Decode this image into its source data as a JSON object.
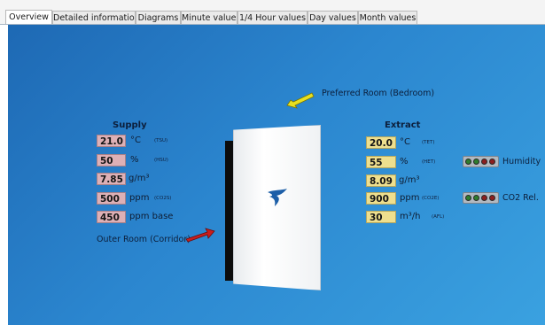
{
  "tabs": [
    "Overview",
    "Detailed information",
    "Diagrams",
    "Minute values",
    "1/4 Hour values",
    "Day values",
    "Month values"
  ],
  "supply": {
    "title": "Supply",
    "temperature": {
      "value": "21.0",
      "unit": "°C",
      "tag": "(TSU)"
    },
    "humidity": {
      "value": "50",
      "unit": "%",
      "tag": "(HSU)"
    },
    "absolute": {
      "value": "7.85",
      "unit": "g/m³"
    },
    "co2": {
      "value": "500",
      "unit": "ppm",
      "tag": "(CO2S)"
    },
    "base": {
      "value": "450",
      "unit": "ppm base"
    }
  },
  "extract": {
    "title": "Extract",
    "temperature": {
      "value": "20.0",
      "unit": "°C",
      "tag": "(TET)"
    },
    "humidity": {
      "value": "55",
      "unit": "%",
      "tag": "(HET)"
    },
    "absolute": {
      "value": "8.09",
      "unit": "g/m³"
    },
    "co2": {
      "value": "900",
      "unit": "ppm",
      "tag": "(CO2E)"
    },
    "flow": {
      "value": "30",
      "unit": "m³/h",
      "tag": "(AFL)"
    }
  },
  "captions": {
    "preferred_room": "Preferred Room (Bedroom)",
    "outer_room": "Outer Room (Corridor)"
  },
  "indicators": {
    "humidity_label": "Humidity",
    "co2_label": "CO2 Rel."
  },
  "colors": {
    "background_start": "#1e69b4",
    "background_end": "#3aa1e0",
    "supply_field": "#ddb0b6",
    "extract_field": "#eedf8e",
    "arrow_yellow": "#e8e020",
    "arrow_red": "#c81e1e",
    "logo_blue": "#1d5fa8",
    "dot_red": "#8c1f1f",
    "dot_green": "#2e7d2e"
  }
}
